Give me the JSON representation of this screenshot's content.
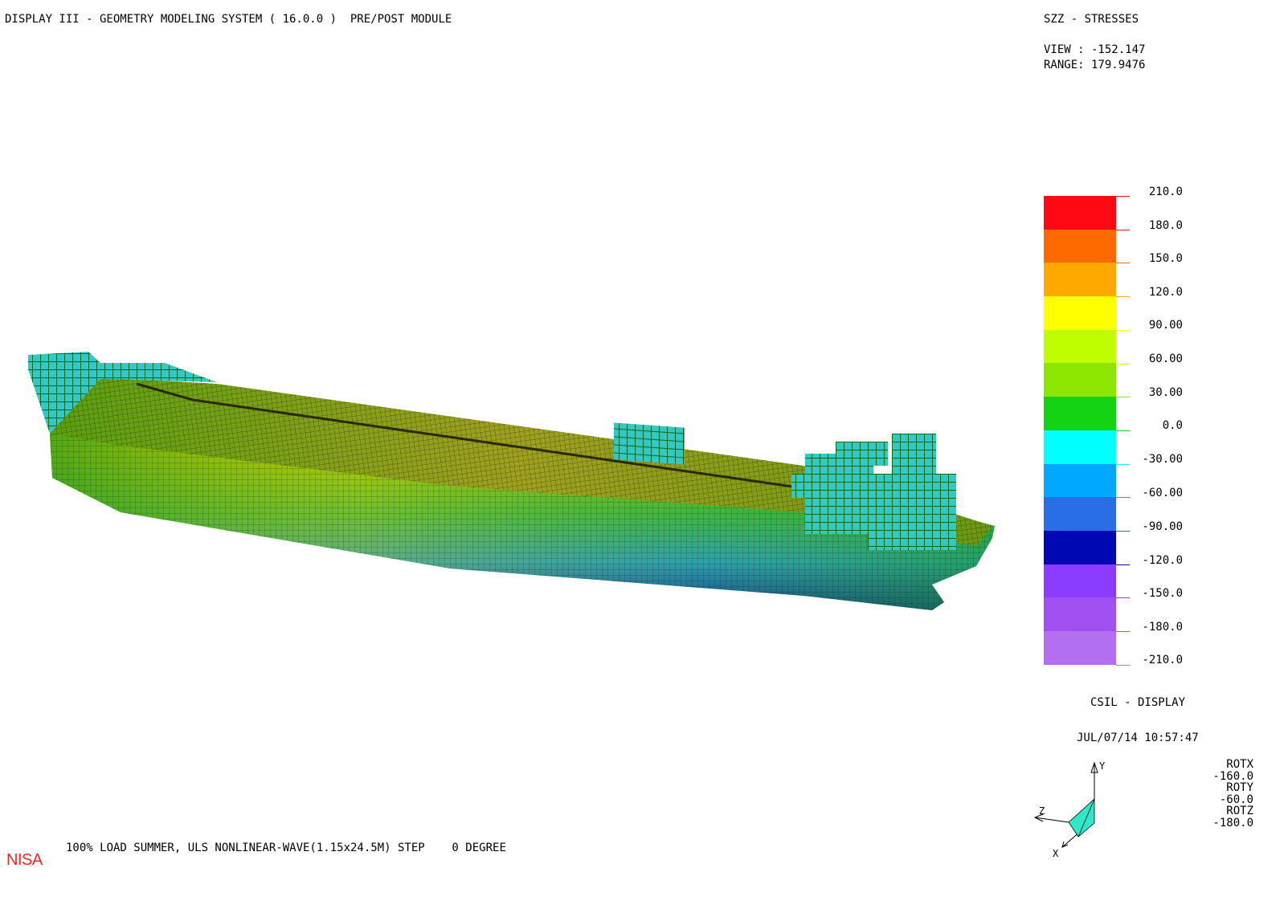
{
  "header": {
    "app_title": "DISPLAY III - GEOMETRY MODELING SYSTEM ( 16.0.0 )  PRE/POST MODULE",
    "result_title": "SZZ - STRESSES",
    "view": "VIEW : -152.147",
    "range": "RANGE: 179.9476"
  },
  "legend": {
    "labels": [
      "210.0",
      "180.0",
      "150.0",
      "120.0",
      "90.00",
      "60.00",
      "30.00",
      "0.0",
      "-30.00",
      "-60.00",
      "-90.00",
      "-120.0",
      "-150.0",
      "-180.0",
      "-210.0"
    ],
    "colors": [
      "#ff0a14",
      "#ff6a00",
      "#ffa800",
      "#ffff00",
      "#c0ff00",
      "#8ce600",
      "#14d214",
      "#00ffff",
      "#00a8ff",
      "#2a6ee6",
      "#0008b4",
      "#8c3cff",
      "#a050f0",
      "#b46ef0"
    ]
  },
  "footer": {
    "csil": "CSIL - DISPLAY",
    "timestamp": "JUL/07/14 10:57:47",
    "caption": "100% LOAD SUMMER, ULS NONLINEAR-WAVE(1.15x24.5M) STEP    0 DEGREE",
    "logo": "NISA"
  },
  "rotation": {
    "rotx_label": "ROTX",
    "rotx_value": "-160.0",
    "roty_label": "ROTY",
    "roty_value": "-60.0",
    "rotz_label": "ROTZ",
    "rotz_value": "-180.0"
  },
  "triad": {
    "y": "Y",
    "z": "Z",
    "x": "X"
  }
}
